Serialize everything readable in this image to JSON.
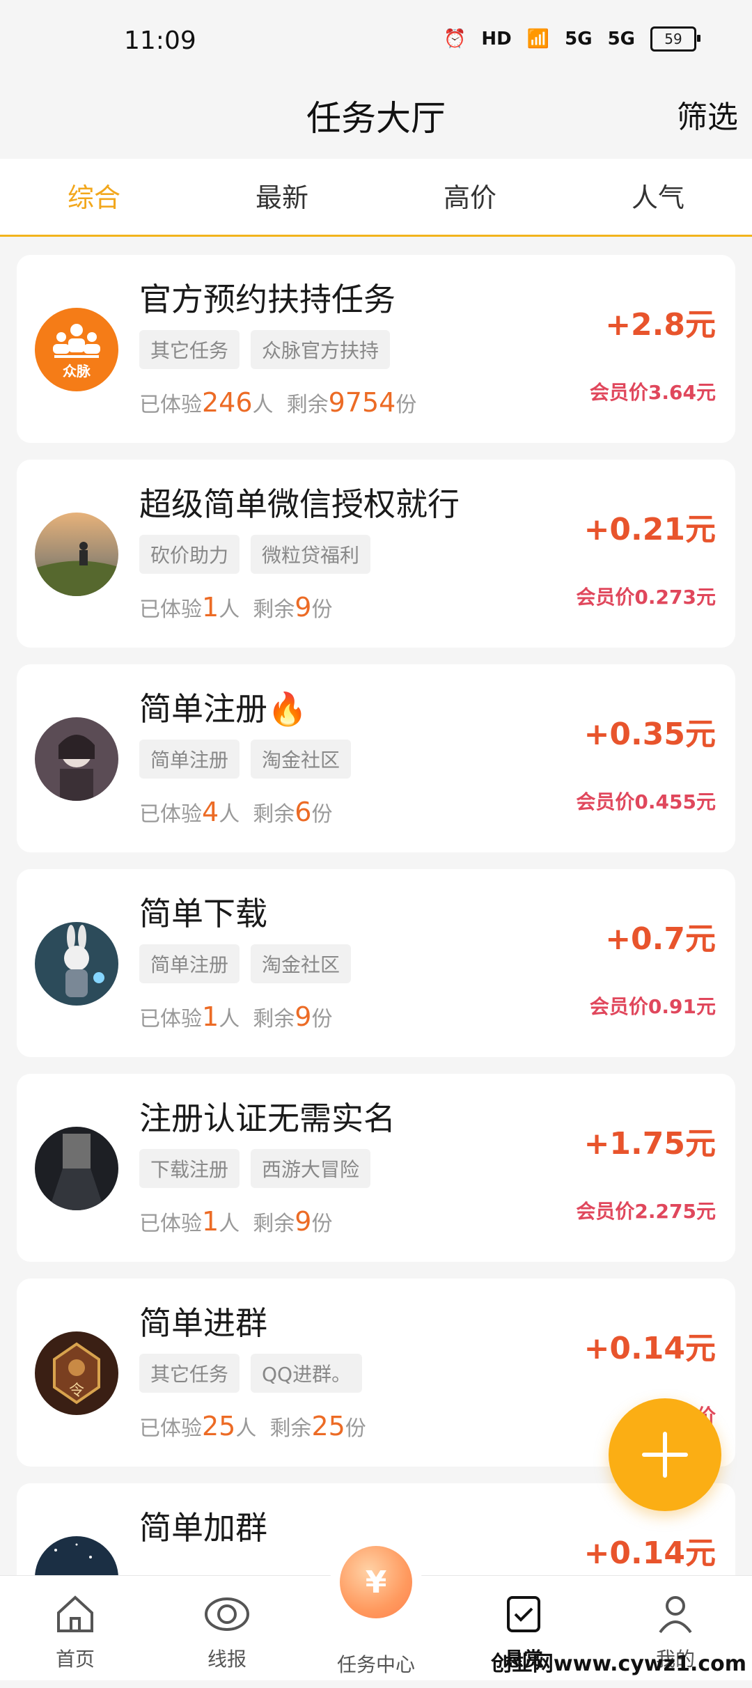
{
  "status_bar": {
    "time": "11:09",
    "hd_label": "HD",
    "signal_a": "5G",
    "signal_b": "5G",
    "battery": "59"
  },
  "header": {
    "title": "任务大厅",
    "filter_label": "筛选"
  },
  "tabs": [
    {
      "label": "综合",
      "active": true
    },
    {
      "label": "最新",
      "active": false
    },
    {
      "label": "高价",
      "active": false
    },
    {
      "label": "人气",
      "active": false
    }
  ],
  "tasks": [
    {
      "title": "官方预约扶持任务",
      "tags": [
        "其它任务",
        "众脉官方扶持"
      ],
      "experienced_prefix": "已体验",
      "experienced": "246",
      "people_unit": "人",
      "remaining_prefix": "剩余",
      "remaining": "9754",
      "remaining_unit": "份",
      "price": "+2.8元",
      "member_price": "会员价3.64元",
      "avatar_label": "众脉"
    },
    {
      "title": "超级简单微信授权就行",
      "tags": [
        "砍价助力",
        "微粒贷福利"
      ],
      "experienced_prefix": "已体验",
      "experienced": "1",
      "people_unit": "人",
      "remaining_prefix": "剩余",
      "remaining": "9",
      "remaining_unit": "份",
      "price": "+0.21元",
      "member_price": "会员价0.273元"
    },
    {
      "title": "简单注册🔥",
      "tags": [
        "简单注册",
        "淘金社区"
      ],
      "experienced_prefix": "已体验",
      "experienced": "4",
      "people_unit": "人",
      "remaining_prefix": "剩余",
      "remaining": "6",
      "remaining_unit": "份",
      "price": "+0.35元",
      "member_price": "会员价0.455元"
    },
    {
      "title": "简单下载",
      "tags": [
        "简单注册",
        "淘金社区"
      ],
      "experienced_prefix": "已体验",
      "experienced": "1",
      "people_unit": "人",
      "remaining_prefix": "剩余",
      "remaining": "9",
      "remaining_unit": "份",
      "price": "+0.7元",
      "member_price": "会员价0.91元"
    },
    {
      "title": "注册认证无需实名",
      "tags": [
        "下载注册",
        "西游大冒险"
      ],
      "experienced_prefix": "已体验",
      "experienced": "1",
      "people_unit": "人",
      "remaining_prefix": "剩余",
      "remaining": "9",
      "remaining_unit": "份",
      "price": "+1.75元",
      "member_price": "会员价2.275元"
    },
    {
      "title": "简单进群",
      "tags": [
        "其它任务",
        "QQ进群。"
      ],
      "experienced_prefix": "已体验",
      "experienced": "25",
      "people_unit": "人",
      "remaining_prefix": "剩余",
      "remaining": "25",
      "remaining_unit": "份",
      "price": "+0.14元",
      "member_price": "会员价"
    },
    {
      "title": "简单加群",
      "tags": [],
      "price": "+0.14元"
    }
  ],
  "bottom_nav": {
    "home": "首页",
    "news": "线报",
    "task_center": "任务中心",
    "center_icon": "¥",
    "reward": "悬赏",
    "mine": "我的"
  },
  "watermark": "创业网www.cywz1.com"
}
